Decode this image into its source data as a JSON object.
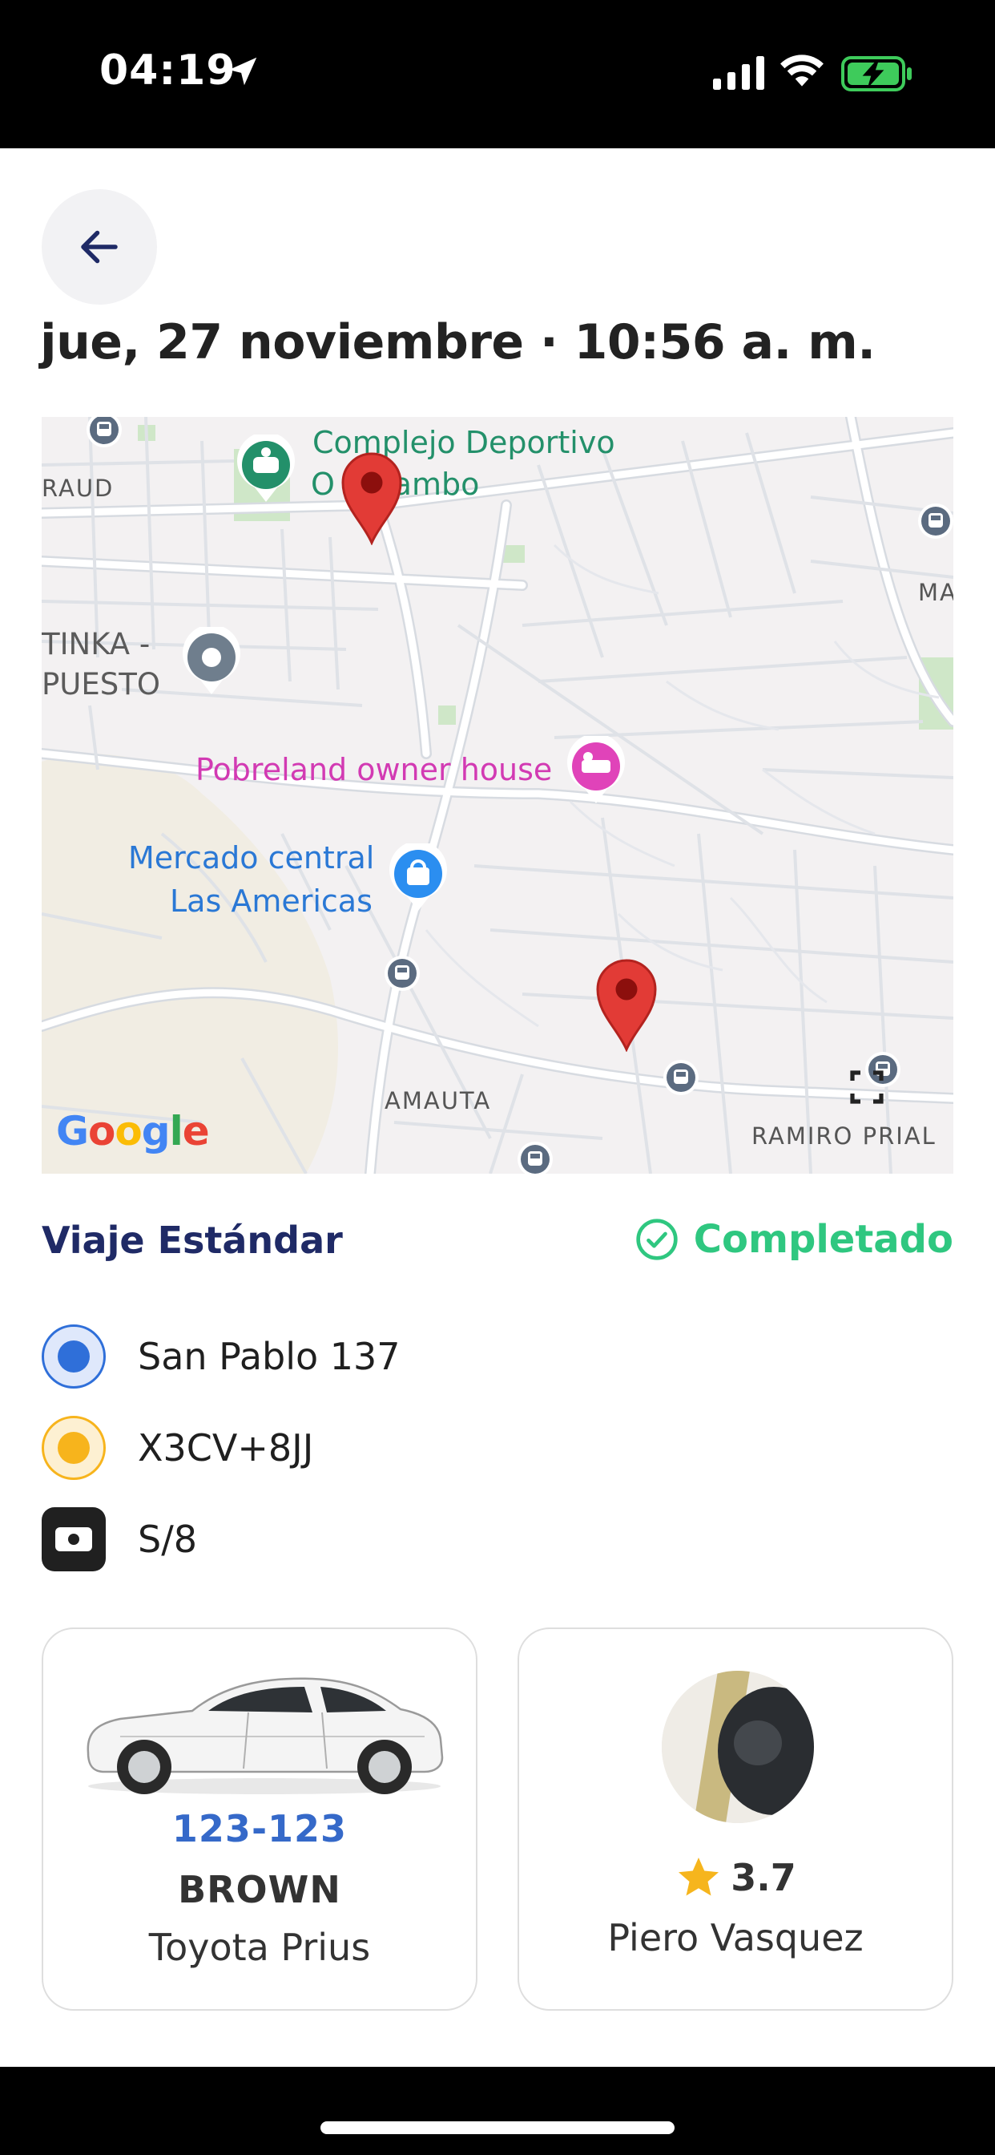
{
  "status_bar": {
    "time": "04:19",
    "icons": [
      "location-arrow-icon",
      "signal-icon",
      "wifi-icon",
      "battery-charging-icon"
    ]
  },
  "header": {
    "back_icon": "arrow-left-icon",
    "title": "jue, 27 noviembre · 10:56 a. m."
  },
  "map": {
    "labels": {
      "complejo_1": "Complejo Deportivo",
      "complejo_2": "O        aytambo",
      "raud": "RAUD",
      "ma": "MA",
      "tinka_1": "TINKA -",
      "tinka_2": "PUESTO",
      "pobreland": "Pobreland owner house",
      "mercado_1": "Mercado central",
      "mercado_2": "Las Americas",
      "amauta": "AMAUTA",
      "ramiro": "RAMIRO PRIAL",
      "google": "Google"
    },
    "colors": {
      "background": "#f3f1f2",
      "road": "#ffffff",
      "road_edge": "#d9dde3",
      "park": "#d5e8cf",
      "pin": "#e23b36",
      "bus_poi": "#5b6b80"
    }
  },
  "trip": {
    "type": "Viaje Estándar",
    "status": "Completado",
    "status_color": "#2fc780",
    "origin": "San Pablo 137",
    "destination": "X3CV+8JJ",
    "payment": "S/8",
    "origin_color": "#2f6fd9",
    "destination_color": "#f7b41c"
  },
  "vehicle": {
    "plate": "123-123",
    "color": "BROWN",
    "model": "Toyota Prius"
  },
  "driver": {
    "rating": "3.7",
    "name": "Piero Vasquez",
    "star_color": "#f6b51d"
  }
}
